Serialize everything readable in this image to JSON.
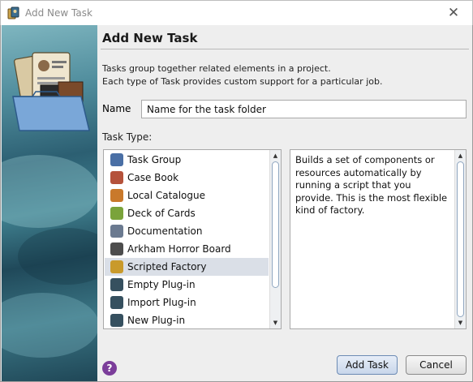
{
  "window": {
    "title": "Add New Task",
    "close_glyph": "✕"
  },
  "dialog": {
    "heading": "Add New Task",
    "description_lines": [
      "Tasks group together related elements in a project.",
      "Each type of Task provides custom support for a particular job."
    ],
    "name_label": "Name",
    "name_value": "Name for the task folder",
    "task_type_label": "Task Type:",
    "task_types": [
      {
        "label": "Task Group",
        "icon": "task-group-icon",
        "color": "#4a6fa5",
        "selected": false
      },
      {
        "label": "Case Book",
        "icon": "case-book-icon",
        "color": "#b5523b",
        "selected": false
      },
      {
        "label": "Local Catalogue",
        "icon": "local-catalogue-icon",
        "color": "#c9792b",
        "selected": false
      },
      {
        "label": "Deck of Cards",
        "icon": "deck-of-cards-icon",
        "color": "#7aa33b",
        "selected": false
      },
      {
        "label": "Documentation",
        "icon": "documentation-icon",
        "color": "#6b7a90",
        "selected": false
      },
      {
        "label": "Arkham Horror Board",
        "icon": "arkham-horror-board-icon",
        "color": "#4d4d4d",
        "selected": false
      },
      {
        "label": "Scripted Factory",
        "icon": "scripted-factory-icon",
        "color": "#c99a2b",
        "selected": true
      },
      {
        "label": "Empty Plug-in",
        "icon": "plugin-icon",
        "color": "#36505f",
        "selected": false
      },
      {
        "label": "Import Plug-in",
        "icon": "plugin-icon",
        "color": "#36505f",
        "selected": false
      },
      {
        "label": "New Plug-in",
        "icon": "plugin-icon",
        "color": "#36505f",
        "selected": false
      }
    ],
    "task_description": "Builds a set of components or resources automatically by running a script that you provide. This is the most flexible kind of factory.",
    "help_glyph": "?",
    "add_button": "Add Task",
    "cancel_button": "Cancel"
  }
}
